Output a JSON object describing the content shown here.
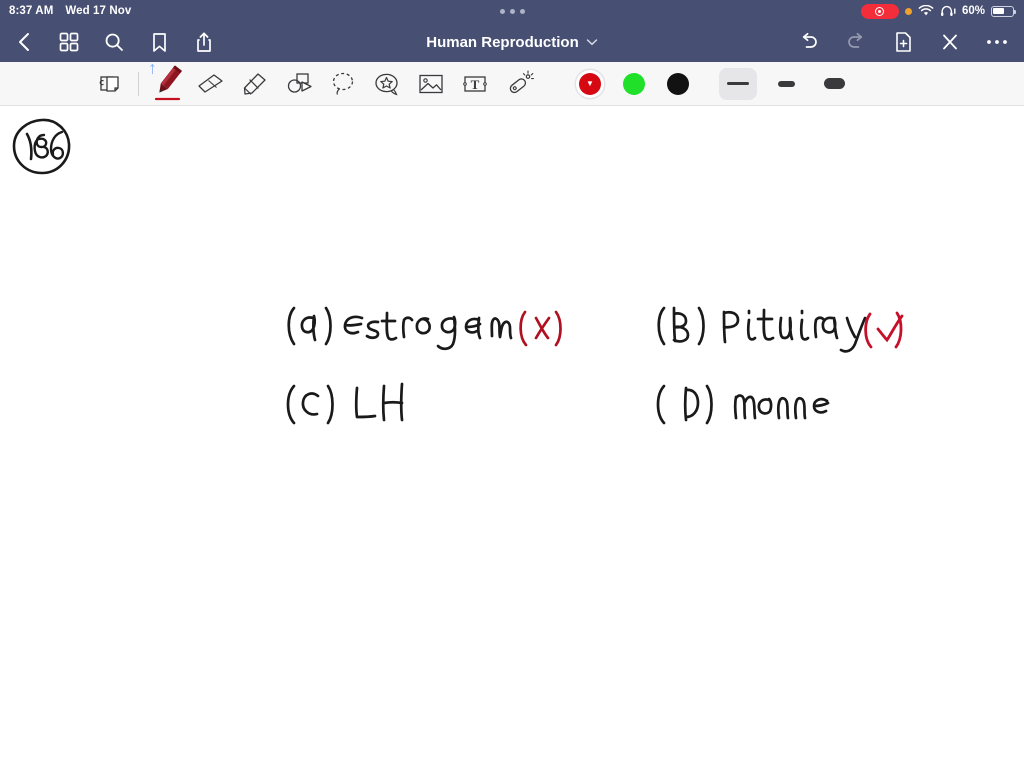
{
  "statusbar": {
    "time": "8:37 AM",
    "date": "Wed 17 Nov",
    "battery_percent": "60%",
    "icons": [
      "screen-recording-pill",
      "orange-privacy-dot",
      "wifi-icon",
      "headphones-icon",
      "battery-icon"
    ],
    "colors": {
      "bar_bg": "#474f72",
      "recording_red": "#f42d3a",
      "privacy_orange": "#f0a22e"
    }
  },
  "navbar": {
    "title": "Human Reproduction",
    "left_icons": [
      "back-icon",
      "grid-icon",
      "search-icon",
      "bookmark-icon",
      "share-icon"
    ],
    "right_icons": [
      "undo-icon",
      "redo-icon",
      "add-page-icon",
      "close-icon",
      "more-icon"
    ],
    "undo_enabled": true,
    "redo_enabled": false
  },
  "toolbar": {
    "tools": [
      {
        "name": "page-layers-tool",
        "selected": false
      },
      {
        "name": "pen-tool",
        "selected": true,
        "bluetooth": true
      },
      {
        "name": "eraser-tool",
        "selected": false
      },
      {
        "name": "highlighter-tool",
        "selected": false
      },
      {
        "name": "shapes-tool",
        "selected": false
      },
      {
        "name": "lasso-select-tool",
        "selected": false
      },
      {
        "name": "sticker-tool",
        "selected": false
      },
      {
        "name": "image-tool",
        "selected": false
      },
      {
        "name": "text-tool",
        "selected": false
      },
      {
        "name": "laser-pointer-tool",
        "selected": false
      }
    ],
    "colors": [
      {
        "name": "color-red",
        "hex": "#d60812",
        "selected": true
      },
      {
        "name": "color-green",
        "hex": "#20e02a",
        "selected": false
      },
      {
        "name": "color-black",
        "hex": "#121212",
        "selected": false
      }
    ],
    "widths": [
      {
        "name": "stroke-thin",
        "selected": true
      },
      {
        "name": "stroke-medium",
        "selected": false
      },
      {
        "name": "stroke-thick",
        "selected": false
      }
    ],
    "pen_color_hex": "#9a1822"
  },
  "canvas": {
    "page_number": "186",
    "answers": [
      {
        "label": "(a) Estrogen",
        "mark": "cross",
        "mark_color": "#b01020"
      },
      {
        "label": "(b) Pituitary",
        "mark": "check",
        "mark_color": "#c6102a"
      },
      {
        "label": "(c) LH",
        "mark": "none"
      },
      {
        "label": "(d) Monnes",
        "mark": "none"
      }
    ],
    "ink_color": "#1a1a1a"
  }
}
